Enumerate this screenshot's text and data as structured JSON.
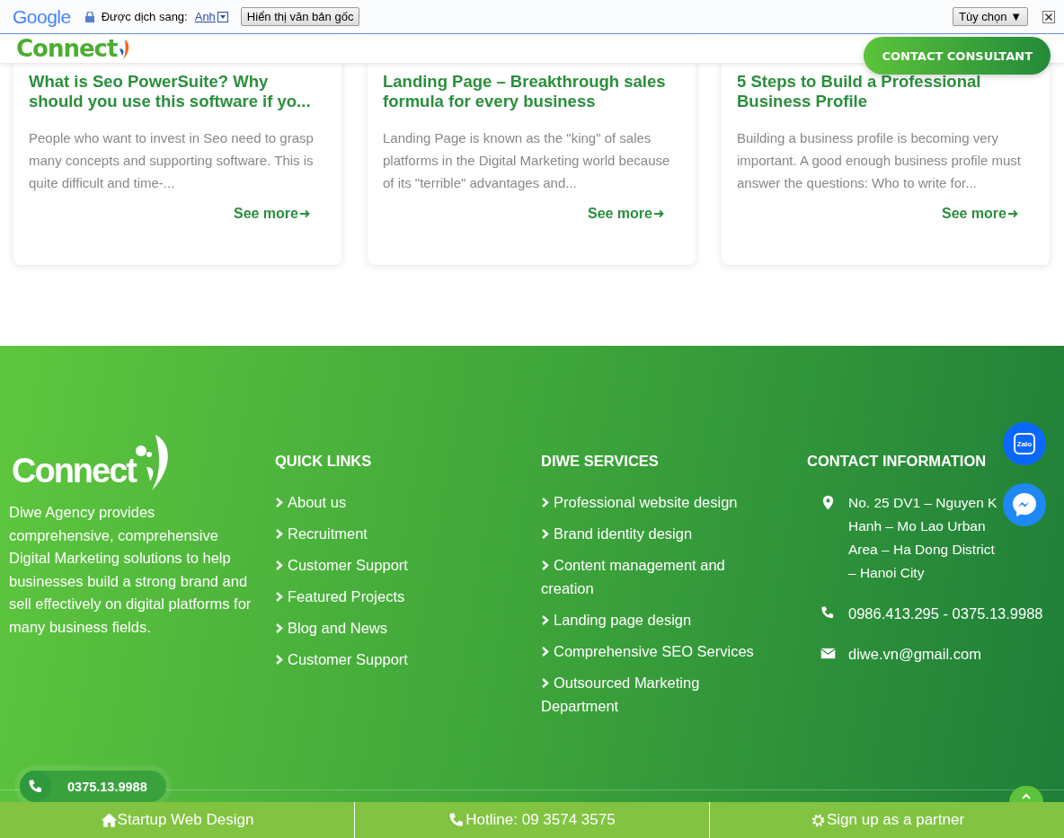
{
  "translate_bar": {
    "brand": "Google",
    "label": "Được dịch sang:",
    "language": "Anh",
    "show_original_button": "Hiển thị văn bản gốc",
    "options_button": "Tùy chọn ▼"
  },
  "header": {
    "logo": "Connect",
    "cta_button": "CONTACT CONSULTANT"
  },
  "posts": [
    {
      "title": "What is Seo PowerSuite? Why should you use this software if yo...",
      "excerpt": "People who want to invest in Seo need to grasp many concepts and supporting software. This is quite difficult and time-...",
      "link": "See more"
    },
    {
      "title": "Landing Page – Breakthrough sales formula for every business",
      "excerpt": "Landing Page is known as the \"king\" of sales platforms in the Digital Marketing world because of its \"terrible\" advantages and...",
      "link": "See more"
    },
    {
      "title": "5 Steps to Build a Professional Business Profile",
      "excerpt": "Building a business profile is becoming very important. A good enough business profile must answer the questions: Who to write for...",
      "link": "See more"
    }
  ],
  "footer": {
    "logo": "Connect",
    "about": "Diwe Agency provides comprehensive, comprehensive Digital Marketing solutions to help businesses build a strong brand and sell effectively on digital platforms for many business fields.",
    "columns": [
      {
        "heading": "QUICK LINKS",
        "links": [
          "About us",
          "Recruitment",
          "Customer Support",
          "Featured Projects",
          "Blog and News",
          "Customer Support"
        ]
      },
      {
        "heading": "DIWE SERVICES",
        "links": [
          "Professional website design",
          "Brand identity design",
          "Content management and creation",
          "Landing page design",
          "Comprehensive SEO Services",
          "Outsourced Marketing Department"
        ]
      }
    ],
    "contact": {
      "heading": "CONTACT INFORMATION",
      "items": [
        {
          "kind": "address",
          "lines": [
            "No. 25 DV1 – Nguyen K",
            "Hanh – Mo Lao Urban Area – Ha Dong District – Hanoi City"
          ]
        },
        {
          "kind": "phone",
          "lines": [
            "0986.413.295 - 0375.13.9988"
          ]
        },
        {
          "kind": "email",
          "lines": [
            "diwe.vn@gmail.com"
          ]
        }
      ]
    }
  },
  "floating": {
    "zalo": "Zalo",
    "phone": "0375.13.9988"
  },
  "bottom_bar": [
    {
      "kind": "home",
      "label": "Startup Web Design"
    },
    {
      "kind": "phone",
      "label": "Hotline: 09 3574 3575"
    },
    {
      "kind": "gear",
      "label": "Sign up as a partner"
    }
  ]
}
